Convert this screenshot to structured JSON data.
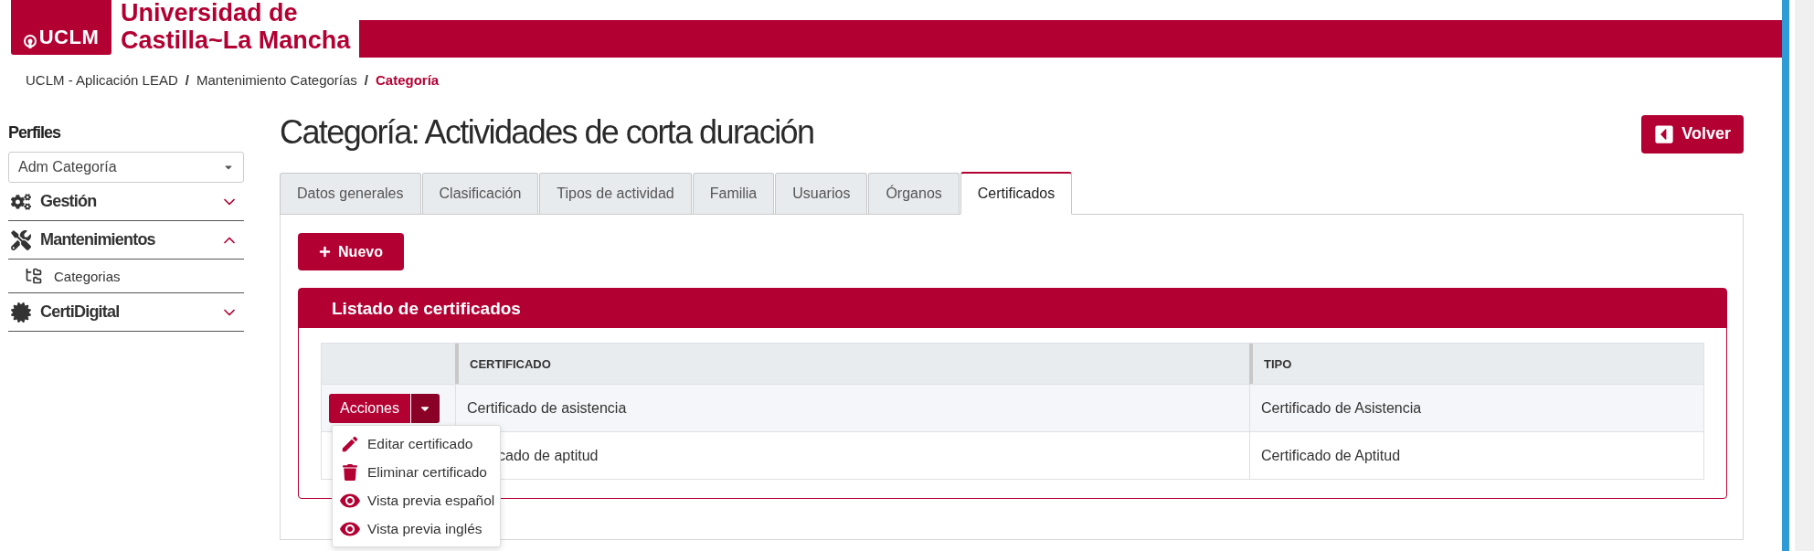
{
  "header": {
    "logo_text": "UCLM",
    "title_lines": [
      "Universidad de",
      "Castilla~La Mancha"
    ]
  },
  "breadcrumb": [
    {
      "label": "UCLM - Aplicación LEAD",
      "selected": false
    },
    {
      "label": "Mantenimiento Categorías",
      "selected": false
    },
    {
      "label": "Categoría",
      "selected": true
    }
  ],
  "breadcrumb_separator": "/",
  "sidebar": {
    "title": "Perfiles",
    "profile_select": {
      "value": "Adm Categoría"
    },
    "items": [
      {
        "label": "Gestión",
        "expanded": false
      },
      {
        "label": "Mantenimientos",
        "expanded": true,
        "children": [
          {
            "label": "Categorias"
          }
        ]
      },
      {
        "label": "CertiDigital",
        "expanded": false
      }
    ]
  },
  "page_title": "Categoría: Actividades de corta duración",
  "back_button": "Volver",
  "tabs": [
    {
      "label": "Datos generales",
      "selected": false
    },
    {
      "label": "Clasificación",
      "selected": false
    },
    {
      "label": "Tipos de actividad",
      "selected": false
    },
    {
      "label": "Familia",
      "selected": false
    },
    {
      "label": "Usuarios",
      "selected": false
    },
    {
      "label": "Órganos",
      "selected": false
    },
    {
      "label": "Certificados",
      "selected": true
    }
  ],
  "new_button": "Nuevo",
  "card": {
    "title": "Listado de certificados",
    "table": {
      "columns": [
        "CERTIFICADO",
        "TIPO"
      ],
      "rows": [
        {
          "actions": {
            "label": "Acciones",
            "open": true,
            "menu": [
              {
                "label": "Editar certificado"
              },
              {
                "label": "Eliminar certificado"
              },
              {
                "label": "Vista previa español"
              },
              {
                "label": "Vista previa inglés"
              }
            ]
          },
          "cells": [
            "Certificado de asistencia",
            "Certificado de Asistencia"
          ]
        },
        {
          "cells": [
            "cado de aptitud",
            "Certificado de Aptitud"
          ]
        }
      ]
    }
  }
}
